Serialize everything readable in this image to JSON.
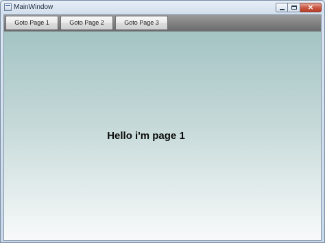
{
  "window": {
    "title": "MainWindow",
    "icon": "app-window-icon"
  },
  "caption_buttons": {
    "minimize_icon": "minimize-icon",
    "maximize_icon": "maximize-icon",
    "close_icon": "close-icon",
    "close_glyph": "×"
  },
  "toolbar": {
    "buttons": [
      {
        "label": "Goto Page 1"
      },
      {
        "label": "Goto Page 2"
      },
      {
        "label": "Goto Page 3"
      }
    ]
  },
  "page": {
    "heading": "Hello i'm page 1"
  },
  "colors": {
    "toolbar_top": "#9a9a9a",
    "toolbar_bottom": "#6a6a6a",
    "page_gradient_top": "#a3c4c3",
    "page_gradient_bottom": "#f8fafa",
    "close_button": "#c8533f"
  }
}
